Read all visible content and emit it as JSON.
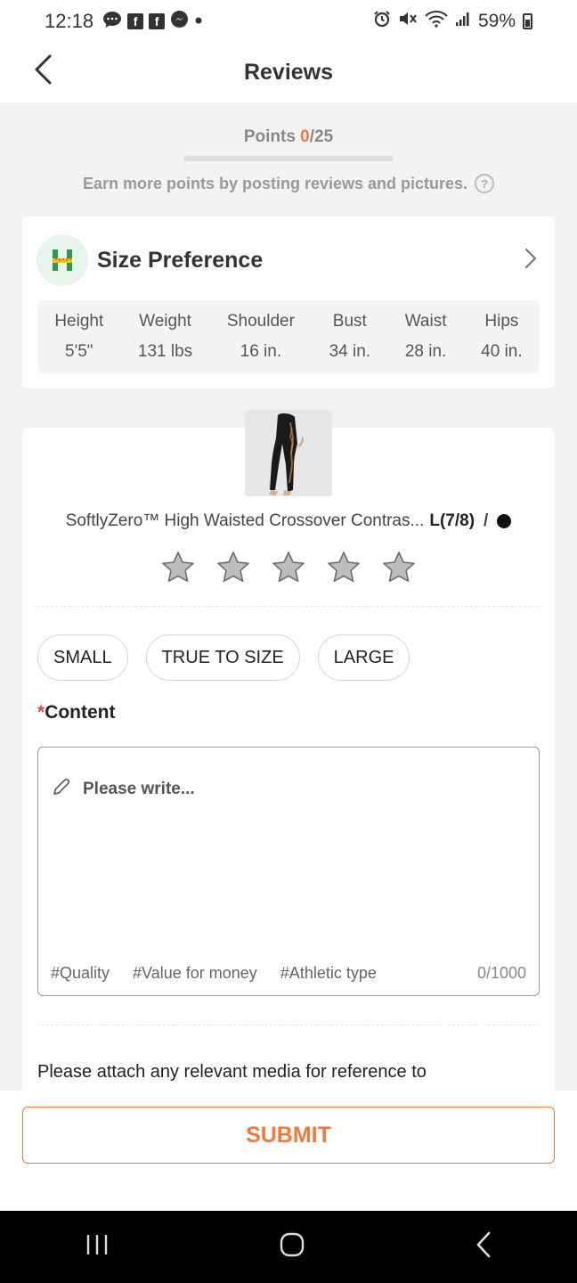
{
  "status_bar": {
    "time": "12:18",
    "battery": "59%",
    "left_icons": [
      "chat-bubble-icon",
      "facebook-icon",
      "facebook-icon",
      "messenger-icon",
      "dot-icon"
    ],
    "right_icons": [
      "alarm-icon",
      "mute-icon",
      "wifi-icon",
      "signal-icon",
      "battery-icon"
    ]
  },
  "nav": {
    "title": "Reviews",
    "back_icon": "chevron-left-icon"
  },
  "points": {
    "label": "Points ",
    "current": "0",
    "total": "/25",
    "progress_fraction": 0,
    "hint": "Earn more points by posting reviews and pictures."
  },
  "size_preference": {
    "title": "Size Preference",
    "icon": "ruler-h-icon",
    "measurements": [
      {
        "label": "Height",
        "value": "5'5\""
      },
      {
        "label": "Weight",
        "value": "131 lbs"
      },
      {
        "label": "Shoulder",
        "value": "16 in."
      },
      {
        "label": "Bust",
        "value": "34 in."
      },
      {
        "label": "Waist",
        "value": "28 in."
      },
      {
        "label": "Hips",
        "value": "40 in."
      }
    ]
  },
  "product": {
    "name": "SoftlyZero™ High Waisted Crossover Contras...",
    "size": "L(7/8)",
    "slash": "/",
    "color_hex": "#111111",
    "rating_stars": 0
  },
  "fit_options": [
    "SMALL",
    "TRUE TO SIZE",
    "LARGE"
  ],
  "content": {
    "required_mark": "*",
    "label": "Content",
    "placeholder": "Please write...",
    "tags": [
      "#Quality",
      "#Value for money",
      "#Athletic type"
    ],
    "char_count": "0/1000"
  },
  "attach_hint": "Please attach any relevant media for reference to",
  "submit_label": "SUBMIT",
  "colors": {
    "accent": "#f07a3c",
    "required": "#e84a3a"
  }
}
